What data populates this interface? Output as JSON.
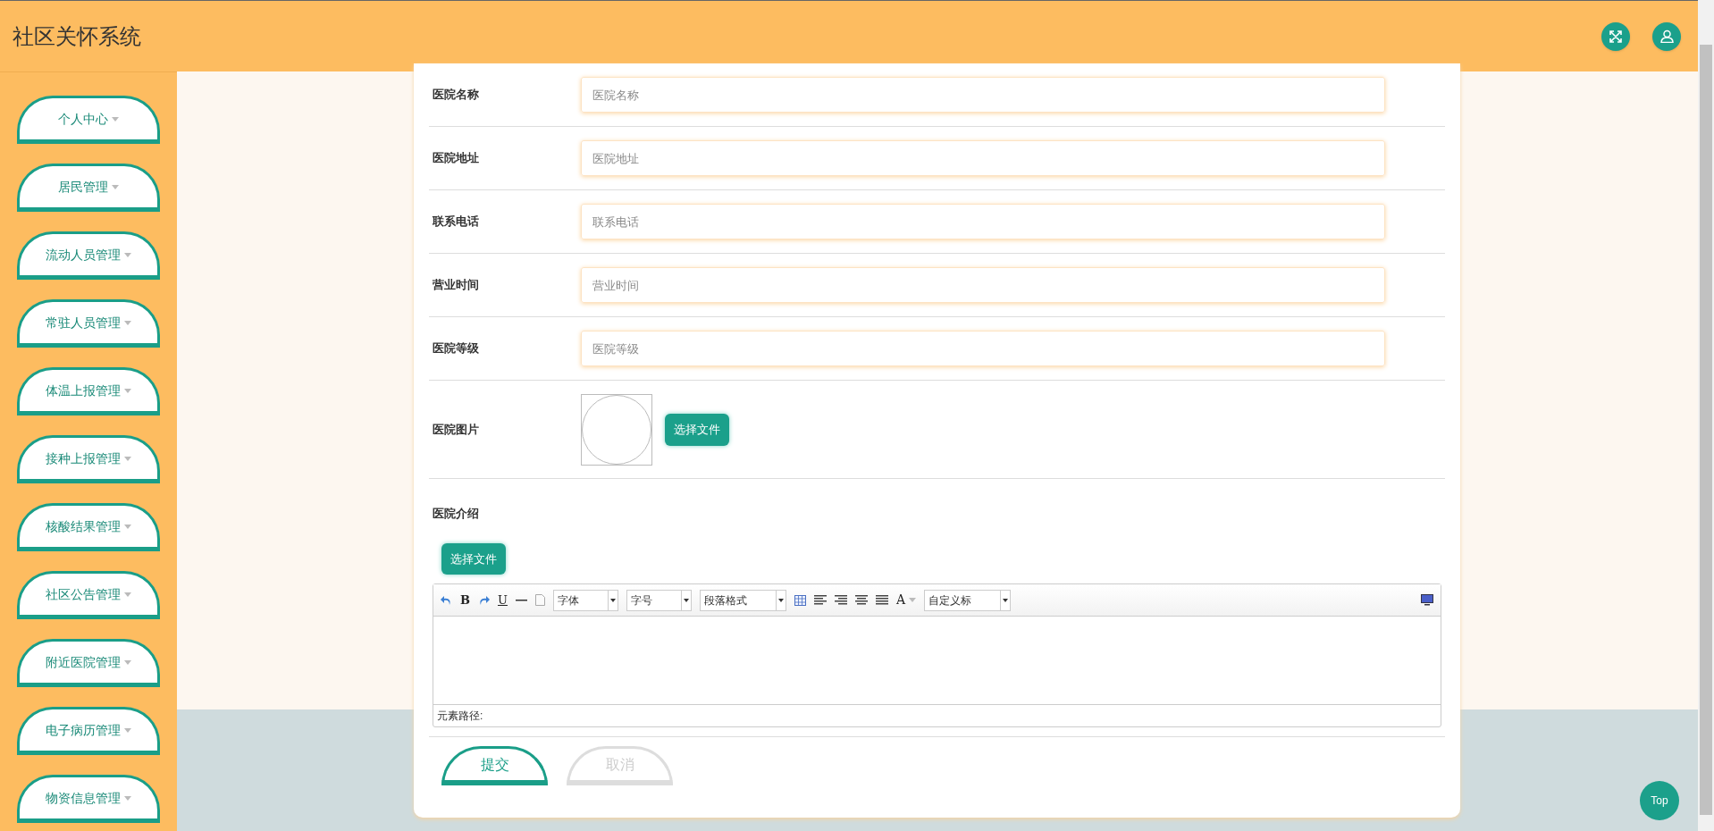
{
  "header": {
    "title": "社区关怀系统"
  },
  "sidebar": {
    "items": [
      {
        "label": "个人中心"
      },
      {
        "label": "居民管理"
      },
      {
        "label": "流动人员管理"
      },
      {
        "label": "常驻人员管理"
      },
      {
        "label": "体温上报管理"
      },
      {
        "label": "接种上报管理"
      },
      {
        "label": "核酸结果管理"
      },
      {
        "label": "社区公告管理"
      },
      {
        "label": "附近医院管理"
      },
      {
        "label": "电子病历管理"
      },
      {
        "label": "物资信息管理"
      }
    ]
  },
  "form": {
    "fields": [
      {
        "label": "医院名称",
        "placeholder": "医院名称"
      },
      {
        "label": "医院地址",
        "placeholder": "医院地址"
      },
      {
        "label": "联系电话",
        "placeholder": "联系电话"
      },
      {
        "label": "营业时间",
        "placeholder": "营业时间"
      },
      {
        "label": "医院等级",
        "placeholder": "医院等级"
      }
    ],
    "image": {
      "label": "医院图片",
      "button": "选择文件"
    },
    "intro": {
      "label": "医院介绍",
      "button": "选择文件"
    },
    "editor": {
      "toolbar": [
        {
          "kind": "undo"
        },
        {
          "kind": "glyph",
          "text": "B"
        },
        {
          "kind": "redo"
        },
        {
          "kind": "underline",
          "text": "U"
        },
        {
          "kind": "hr"
        },
        {
          "kind": "page"
        },
        {
          "kind": "select",
          "text": "字体"
        },
        {
          "kind": "select",
          "text": "字号"
        },
        {
          "kind": "select",
          "text": "段落格式"
        },
        {
          "kind": "table"
        },
        {
          "kind": "align-left"
        },
        {
          "kind": "align-right"
        },
        {
          "kind": "align-center"
        },
        {
          "kind": "justify"
        },
        {
          "kind": "color",
          "text": "A"
        },
        {
          "kind": "select",
          "text": "自定义标"
        }
      ],
      "path_label": "元素路径:"
    },
    "buttons": [
      {
        "label": "提交",
        "kind": "primary"
      },
      {
        "label": "取消",
        "kind": "secondary"
      }
    ]
  },
  "top_button": "Top"
}
